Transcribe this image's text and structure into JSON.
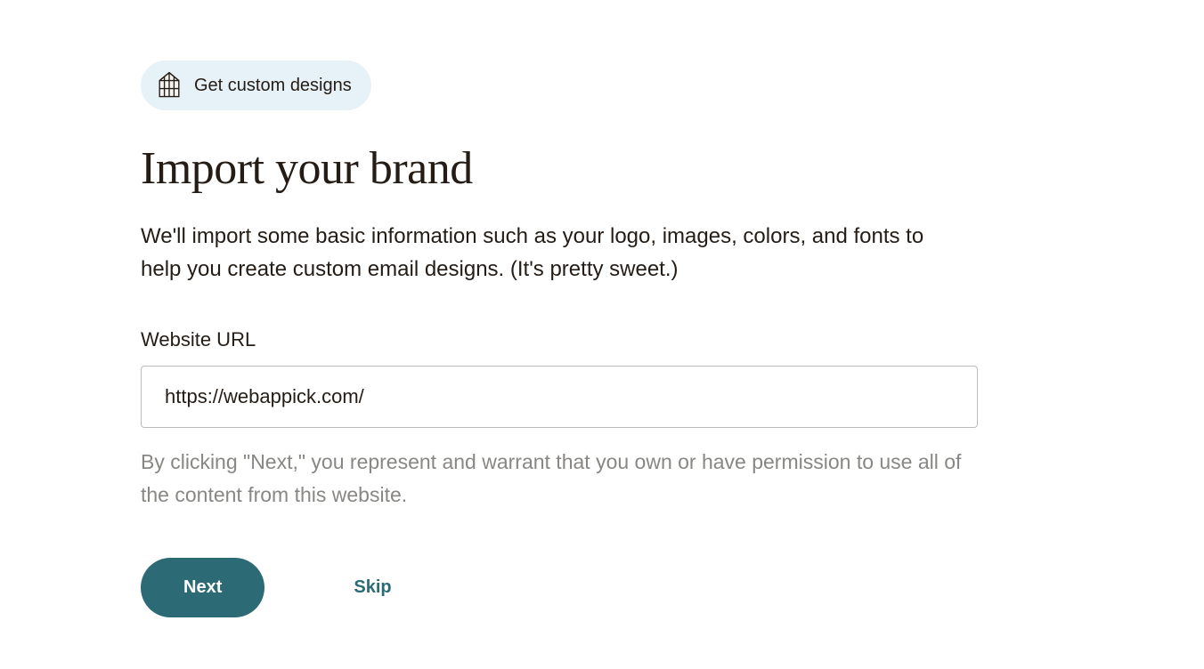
{
  "badge": {
    "label": "Get custom designs"
  },
  "heading": "Import your brand",
  "description": "We'll import some basic information such as your logo, images, colors, and fonts to help you create custom email designs. (It's pretty sweet.)",
  "form": {
    "url_label": "Website URL",
    "url_value": "https://webappick.com/",
    "disclaimer": "By clicking \"Next,\" you represent and warrant that you own or have permission to use all of the content from this website."
  },
  "buttons": {
    "next": "Next",
    "skip": "Skip"
  }
}
